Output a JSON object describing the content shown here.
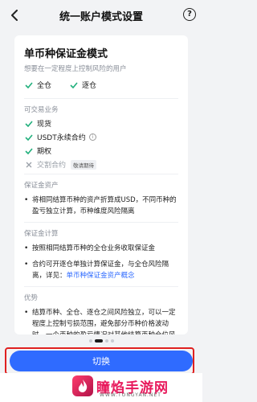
{
  "header": {
    "title": "统一账户模式设置",
    "help_icon": "?"
  },
  "card": {
    "title": "单币种保证金模式",
    "subtitle": "想要在一定程度上控制风险的用户",
    "modes": [
      {
        "label": "全仓",
        "checked": true
      },
      {
        "label": "逐仓",
        "checked": true
      }
    ],
    "tradable": {
      "label": "可交易业务",
      "items": [
        {
          "label": "现货",
          "enabled": true
        },
        {
          "label": "USDT永续合约",
          "enabled": true,
          "info": "i"
        },
        {
          "label": "期权",
          "enabled": true
        },
        {
          "label": "交割合约",
          "enabled": false,
          "tag": "敬请期待"
        }
      ]
    },
    "margin_assets": {
      "label": "保证金资产",
      "bullets": [
        "将相同结算币种的资产折算成USD，不同币种的盈亏独立计算，币种维度风险隔离"
      ]
    },
    "margin_calc": {
      "label": "保证金计算",
      "bullet1": "按照相同结算币种的全仓业务收取保证金",
      "bullet2_text": "合约可开逐仓单独计算保证金，与全仓风险隔离，详见：",
      "bullet2_link": "单币种保证金资产概念"
    },
    "advantages": {
      "label": "优势",
      "bullets": [
        "结算币种、全仓、逐仓之间风险独立，可以一定程度上控制亏损范围，避免部分币种价格波动时，一个币种的盈亏情况对其他结算币种仓位风险造成影响，风险可控制在一定范围内"
      ]
    }
  },
  "pager": {
    "count": 4,
    "active": 1
  },
  "switch_button": {
    "label": "切换"
  },
  "watermark": {
    "name": "瞳焰手游网",
    "url": "WWW.TONGYAN.NET"
  },
  "colors": {
    "accent": "#2f6bff",
    "check": "#22b07d",
    "highlight": "#e02020"
  }
}
